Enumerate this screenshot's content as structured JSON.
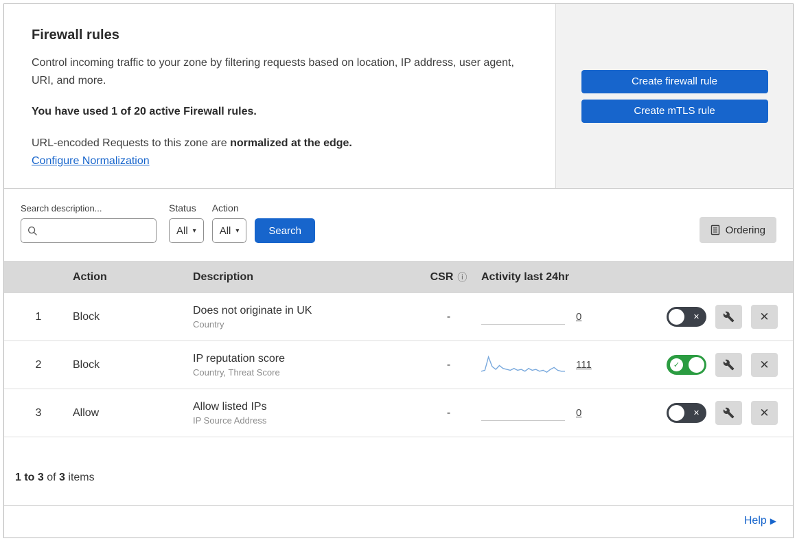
{
  "colors": {
    "accent": "#1765cc",
    "link": "#1765cc",
    "panel_bg": "#f2f2f2",
    "header_bg": "#d9d9d9",
    "toggle_on": "#2b9c41",
    "toggle_off": "#3c4149",
    "spark": "#79a9dd"
  },
  "icons": {
    "chevron": "▾",
    "info": "ⓘ",
    "close": "✕",
    "check": "✓",
    "help_arrow": "▶"
  },
  "header": {
    "title": "Firewall rules",
    "description": "Control incoming traffic to your zone by filtering requests based on location, IP address, user agent, URI, and more.",
    "usage": "You have used 1 of 20 active Firewall rules.",
    "normalization_prefix": "URL-encoded Requests to this zone are",
    "normalization_bold": "normalized at the edge.",
    "normalization_link": "Configure Normalization",
    "create_firewall_button": "Create firewall rule",
    "create_mtls_button": "Create mTLS rule"
  },
  "filters": {
    "search_label": "Search description...",
    "status_label": "Status",
    "status_value": "All",
    "action_label": "Action",
    "action_value": "All",
    "search_button": "Search",
    "ordering_button": "Ordering"
  },
  "table": {
    "headers": {
      "action": "Action",
      "description": "Description",
      "csr": "CSR",
      "activity": "Activity last 24hr"
    },
    "rows": [
      {
        "index": "1",
        "action": "Block",
        "description": "Does not originate in UK",
        "fields": "Country",
        "csr": "-",
        "activity_count": "0",
        "enabled": false,
        "sparkline": []
      },
      {
        "index": "2",
        "action": "Block",
        "description": "IP reputation score",
        "fields": "Country, Threat Score",
        "csr": "-",
        "activity_count": "111",
        "enabled": true,
        "sparkline": [
          3,
          4,
          18,
          8,
          5,
          9,
          6,
          5,
          4,
          6,
          4,
          5,
          3,
          6,
          4,
          5,
          3,
          4,
          2,
          5,
          7,
          4,
          3,
          3
        ]
      },
      {
        "index": "3",
        "action": "Allow",
        "description": "Allow listed IPs",
        "fields": "IP Source Address",
        "csr": "-",
        "activity_count": "0",
        "enabled": false,
        "sparkline": []
      }
    ]
  },
  "footer": {
    "range": "1 to 3",
    "of": "of",
    "total": "3",
    "items": "items"
  },
  "help_link": "Help"
}
